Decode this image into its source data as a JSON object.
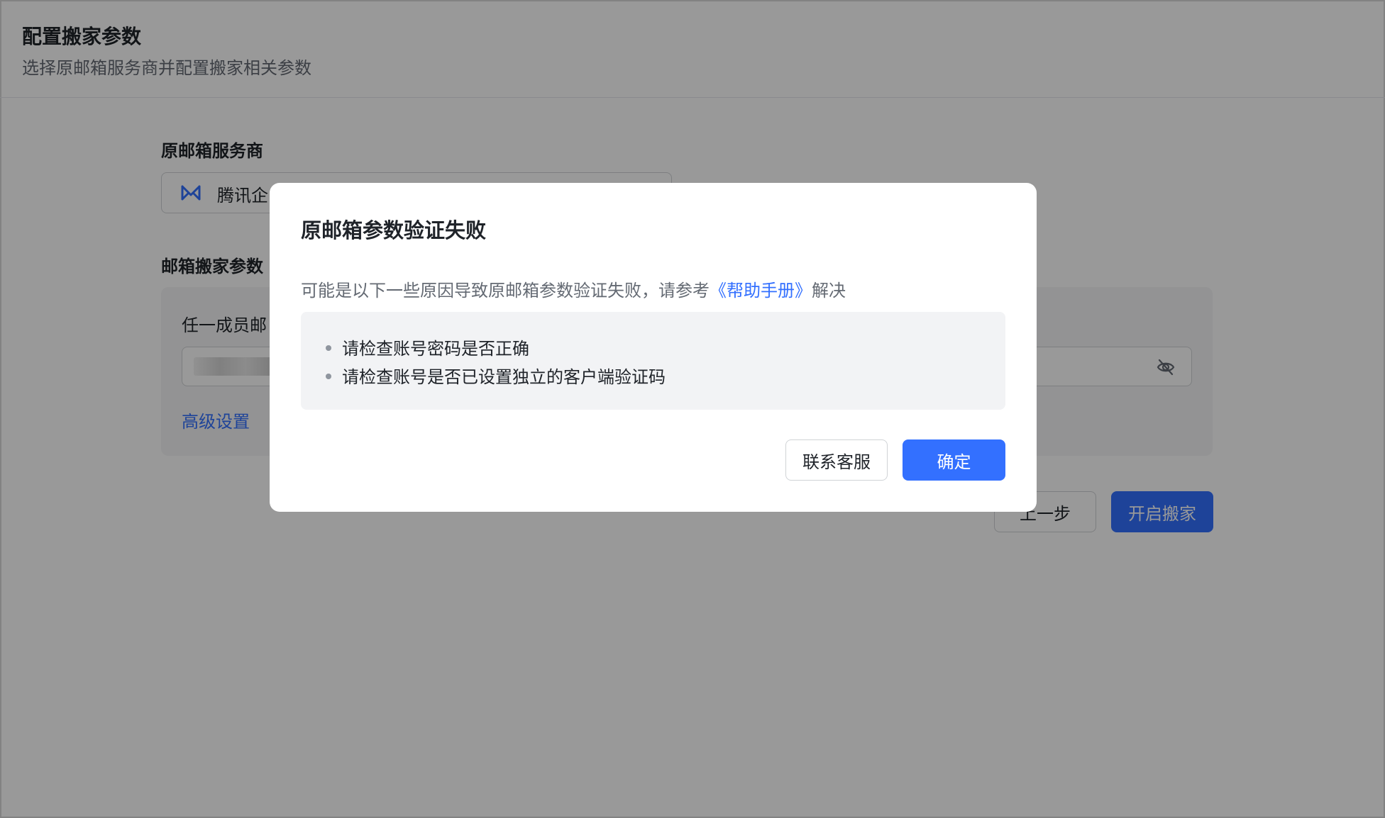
{
  "header": {
    "title": "配置搬家参数",
    "subtitle": "选择原邮箱服务商并配置搬家相关参数"
  },
  "form": {
    "provider_label": "原邮箱服务商",
    "provider_value": "腾讯企",
    "params_label": "邮箱搬家参数",
    "member_field_label": "任一成员邮",
    "advanced_link": "高级设置"
  },
  "footer": {
    "prev_button": "上一步",
    "start_button": "开启搬家"
  },
  "dialog": {
    "title": "原邮箱参数验证失败",
    "desc_prefix": "可能是以下一些原因导致原邮箱参数验证失败，请参考",
    "help_link": "《帮助手册》",
    "desc_suffix": "解决",
    "reasons": [
      "请检查账号密码是否正确",
      "请检查账号是否已设置独立的客户端验证码"
    ],
    "contact_button": "联系客服",
    "ok_button": "确定"
  },
  "colors": {
    "primary": "#3370ff",
    "mask": "rgba(0,0,0,0.4)"
  },
  "icons": {
    "provider": "tencent-exmail-icon",
    "password_toggle": "eye-off-icon"
  }
}
